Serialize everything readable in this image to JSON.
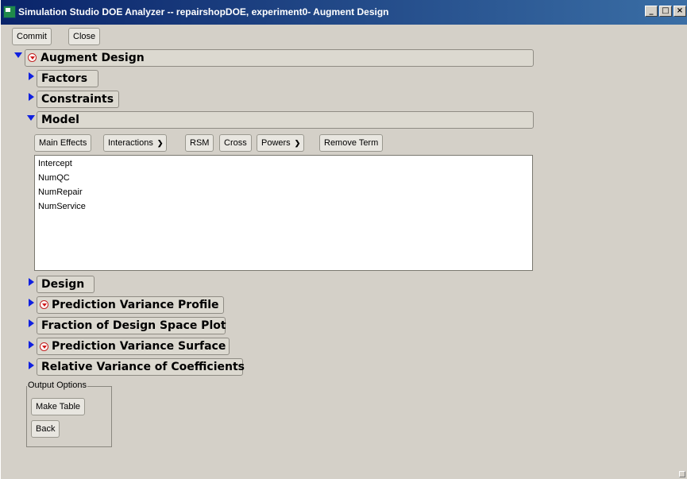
{
  "window": {
    "title": "Simulation Studio DOE Analyzer -- repairshopDOE, experiment0- Augment Design",
    "controls": {
      "minimize": "_",
      "maximize": "□",
      "close": "×"
    }
  },
  "toolbar": {
    "commit": "Commit",
    "close": "Close"
  },
  "outline": {
    "augment_design": "Augment Design",
    "factors": "Factors",
    "constraints": "Constraints",
    "model": "Model",
    "design": "Design",
    "prediction_variance_profile": "Prediction Variance Profile",
    "fraction_design_space": "Fraction of Design Space Plot",
    "prediction_variance_surface": "Prediction Variance Surface",
    "relative_variance_coefficients": "Relative Variance of Coefficients"
  },
  "model_buttons": {
    "main_effects": "Main Effects",
    "interactions": "Interactions",
    "rsm": "RSM",
    "cross": "Cross",
    "powers": "Powers",
    "remove_term": "Remove Term"
  },
  "model_terms": [
    "Intercept",
    "NumQC",
    "NumRepair",
    "NumService"
  ],
  "output_options": {
    "label": "Output Options",
    "make_table": "Make Table",
    "back": "Back"
  },
  "icons": {
    "app": "simulation-studio-icon",
    "disclosure_open": "blue-down-triangle",
    "disclosure_closed": "blue-right-triangle",
    "menu": "red-hotspot-menu"
  },
  "colors": {
    "disclosure": "#1020e0",
    "hotspot": "#d01818",
    "title_start": "#0a246a",
    "title_end": "#3a6ea5"
  }
}
